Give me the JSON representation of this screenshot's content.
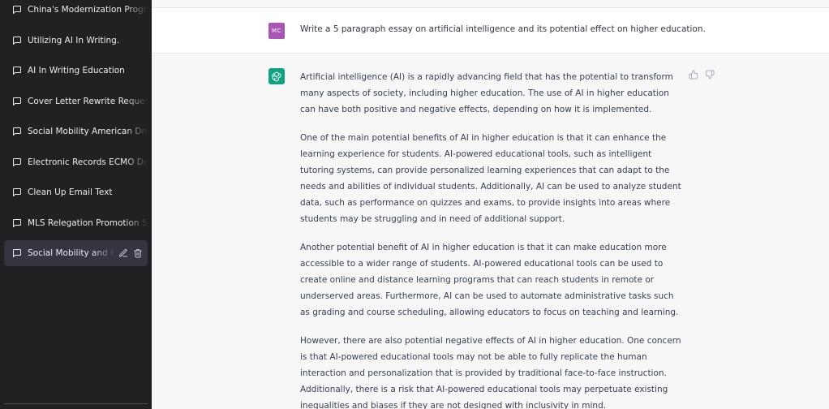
{
  "sidebar": {
    "items": [
      {
        "label": "China's Modernization Progr",
        "active": false
      },
      {
        "label": "Utilizing AI In Writing.",
        "active": false
      },
      {
        "label": "AI In Writing Education",
        "active": false
      },
      {
        "label": "Cover Letter Rewrite Request",
        "active": false
      },
      {
        "label": "Social Mobility American Dre",
        "active": false
      },
      {
        "label": "Electronic Records ECMO Do",
        "active": false
      },
      {
        "label": "Clean Up Email Text",
        "active": false
      },
      {
        "label": "MLS Relegation Promotion S",
        "active": false
      },
      {
        "label": "Social Mobility and Fr",
        "active": true
      }
    ],
    "icons": {
      "chat": "chat-bubble-icon",
      "edit": "pencil-icon",
      "delete": "trash-icon"
    }
  },
  "conversation": {
    "user": {
      "avatar_text": "MC",
      "avatar_color": "#a855b5",
      "message": "Write a 5 paragraph essay on artificial intelligence and its potential effect on higher education."
    },
    "assistant": {
      "avatar_icon": "openai-logo-icon",
      "avatar_color": "#10a37f",
      "paragraphs": [
        "Artificial intelligence (AI) is a rapidly advancing field that has the potential to transform many aspects of society, including higher education. The use of AI in higher education can have both positive and negative effects, depending on how it is implemented.",
        "One of the main potential benefits of AI in higher education is that it can enhance the learning experience for students. AI-powered educational tools, such as intelligent tutoring systems, can provide personalized learning experiences that can adapt to the needs and abilities of individual students. Additionally, AI can be used to analyze student data, such as performance on quizzes and exams, to provide insights into areas where students may be struggling and in need of additional support.",
        "Another potential benefit of AI in higher education is that it can make education more accessible to a wider range of students. AI-powered educational tools can be used to create online and distance learning programs that can reach students in remote or underserved areas. Furthermore, AI can be used to automate administrative tasks such as grading and course scheduling, allowing educators to focus on teaching and learning.",
        "However, there are also potential negative effects of AI in higher education. One concern is that AI-powered educational tools may not be able to fully replicate the human interaction and personalization that is provided by traditional face-to-face instruction. Additionally, there is a risk that AI-powered educational tools may perpetuate existing inequalities and biases if they are not designed with inclusivity in mind."
      ],
      "feedback_icons": [
        "thumbs-up-icon",
        "thumbs-down-icon"
      ]
    }
  }
}
